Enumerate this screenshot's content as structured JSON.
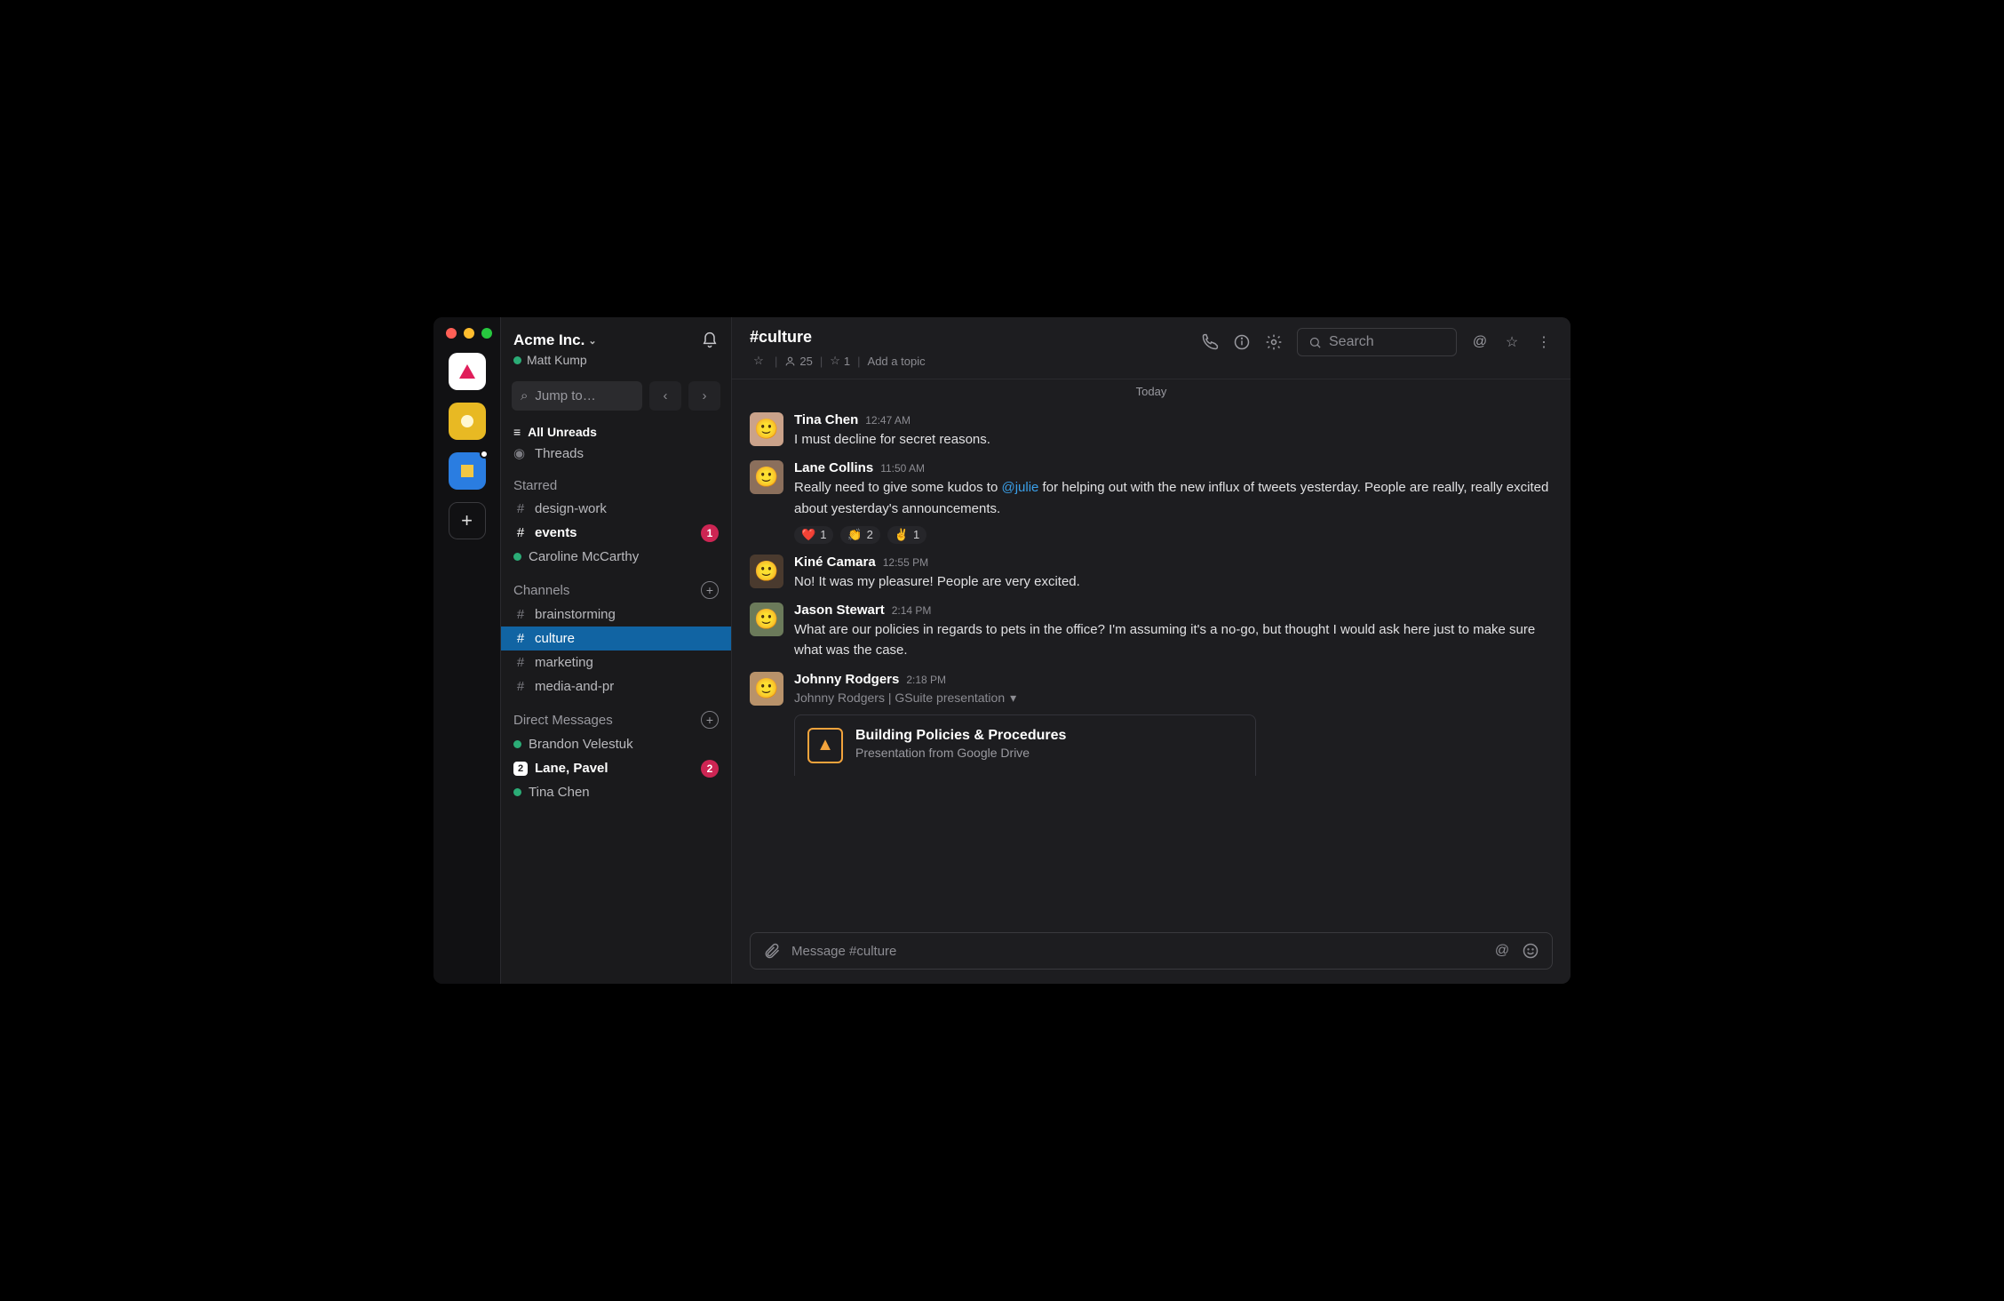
{
  "workspace": {
    "name": "Acme Inc.",
    "user": "Matt Kump"
  },
  "sidebar": {
    "jump_placeholder": "Jump to…",
    "all_unreads": "All Unreads",
    "threads": "Threads",
    "starred_heading": "Starred",
    "starred": [
      {
        "type": "channel",
        "label": "design-work",
        "bold": false
      },
      {
        "type": "channel",
        "label": "events",
        "bold": true,
        "badge": "1"
      },
      {
        "type": "dm",
        "label": "Caroline McCarthy",
        "bold": false
      }
    ],
    "channels_heading": "Channels",
    "channels": [
      {
        "label": "brainstorming",
        "active": false
      },
      {
        "label": "culture",
        "active": true
      },
      {
        "label": "marketing",
        "active": false
      },
      {
        "label": "media-and-pr",
        "active": false
      }
    ],
    "dms_heading": "Direct Messages",
    "dms": [
      {
        "label": "Brandon Velestuk",
        "bold": false
      },
      {
        "label": "Lane, Pavel",
        "bold": true,
        "count": "2",
        "badge": "2"
      },
      {
        "label": "Tina Chen",
        "bold": false
      }
    ]
  },
  "header": {
    "channel": "#culture",
    "members": "25",
    "pins": "1",
    "add_topic": "Add a topic",
    "search_placeholder": "Search",
    "date": "Today"
  },
  "messages": [
    {
      "author": "Tina Chen",
      "time": "12:47 AM",
      "avatar": "#caa28a",
      "text": "I must decline for secret reasons."
    },
    {
      "author": "Lane Collins",
      "time": "11:50 AM",
      "avatar": "#8b6f5c",
      "text_pre": "Really need to give some kudos to ",
      "mention": "@julie",
      "text_post": " for helping out with the new influx of tweets yesterday. People are really, really excited about yesterday's announcements.",
      "reactions": [
        {
          "emoji": "❤️",
          "count": "1"
        },
        {
          "emoji": "👏",
          "count": "2"
        },
        {
          "emoji": "✌️",
          "count": "1"
        }
      ]
    },
    {
      "author": "Kiné Camara",
      "time": "12:55 PM",
      "avatar": "#4a3a2e",
      "text": "No! It was my pleasure! People are very excited."
    },
    {
      "author": "Jason Stewart",
      "time": "2:14 PM",
      "avatar": "#6b7a5a",
      "text": "What are our policies in regards to pets in the office? I'm assuming it's a no-go, but thought I would ask here just to make sure what was the case."
    },
    {
      "author": "Johnny Rodgers",
      "time": "2:18 PM",
      "avatar": "#b8926a",
      "attach_label": "Johnny Rodgers | GSuite presentation",
      "attach_title": "Building Policies & Procedures",
      "attach_sub": "Presentation from Google Drive"
    }
  ],
  "composer": {
    "placeholder": "Message #culture"
  }
}
